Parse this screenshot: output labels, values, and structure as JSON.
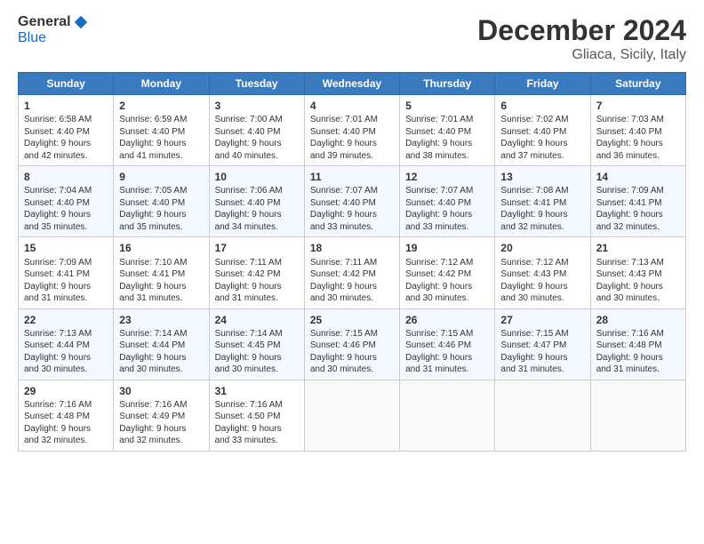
{
  "header": {
    "logo_general": "General",
    "logo_blue": "Blue",
    "title": "December 2024",
    "subtitle": "Gliaca, Sicily, Italy"
  },
  "days_of_week": [
    "Sunday",
    "Monday",
    "Tuesday",
    "Wednesday",
    "Thursday",
    "Friday",
    "Saturday"
  ],
  "weeks": [
    [
      {
        "day": "1",
        "sunrise": "6:58 AM",
        "sunset": "4:40 PM",
        "daylight": "9 hours and 42 minutes."
      },
      {
        "day": "2",
        "sunrise": "6:59 AM",
        "sunset": "4:40 PM",
        "daylight": "9 hours and 41 minutes."
      },
      {
        "day": "3",
        "sunrise": "7:00 AM",
        "sunset": "4:40 PM",
        "daylight": "9 hours and 40 minutes."
      },
      {
        "day": "4",
        "sunrise": "7:01 AM",
        "sunset": "4:40 PM",
        "daylight": "9 hours and 39 minutes."
      },
      {
        "day": "5",
        "sunrise": "7:01 AM",
        "sunset": "4:40 PM",
        "daylight": "9 hours and 38 minutes."
      },
      {
        "day": "6",
        "sunrise": "7:02 AM",
        "sunset": "4:40 PM",
        "daylight": "9 hours and 37 minutes."
      },
      {
        "day": "7",
        "sunrise": "7:03 AM",
        "sunset": "4:40 PM",
        "daylight": "9 hours and 36 minutes."
      }
    ],
    [
      {
        "day": "8",
        "sunrise": "7:04 AM",
        "sunset": "4:40 PM",
        "daylight": "9 hours and 35 minutes."
      },
      {
        "day": "9",
        "sunrise": "7:05 AM",
        "sunset": "4:40 PM",
        "daylight": "9 hours and 35 minutes."
      },
      {
        "day": "10",
        "sunrise": "7:06 AM",
        "sunset": "4:40 PM",
        "daylight": "9 hours and 34 minutes."
      },
      {
        "day": "11",
        "sunrise": "7:07 AM",
        "sunset": "4:40 PM",
        "daylight": "9 hours and 33 minutes."
      },
      {
        "day": "12",
        "sunrise": "7:07 AM",
        "sunset": "4:40 PM",
        "daylight": "9 hours and 33 minutes."
      },
      {
        "day": "13",
        "sunrise": "7:08 AM",
        "sunset": "4:41 PM",
        "daylight": "9 hours and 32 minutes."
      },
      {
        "day": "14",
        "sunrise": "7:09 AM",
        "sunset": "4:41 PM",
        "daylight": "9 hours and 32 minutes."
      }
    ],
    [
      {
        "day": "15",
        "sunrise": "7:09 AM",
        "sunset": "4:41 PM",
        "daylight": "9 hours and 31 minutes."
      },
      {
        "day": "16",
        "sunrise": "7:10 AM",
        "sunset": "4:41 PM",
        "daylight": "9 hours and 31 minutes."
      },
      {
        "day": "17",
        "sunrise": "7:11 AM",
        "sunset": "4:42 PM",
        "daylight": "9 hours and 31 minutes."
      },
      {
        "day": "18",
        "sunrise": "7:11 AM",
        "sunset": "4:42 PM",
        "daylight": "9 hours and 30 minutes."
      },
      {
        "day": "19",
        "sunrise": "7:12 AM",
        "sunset": "4:42 PM",
        "daylight": "9 hours and 30 minutes."
      },
      {
        "day": "20",
        "sunrise": "7:12 AM",
        "sunset": "4:43 PM",
        "daylight": "9 hours and 30 minutes."
      },
      {
        "day": "21",
        "sunrise": "7:13 AM",
        "sunset": "4:43 PM",
        "daylight": "9 hours and 30 minutes."
      }
    ],
    [
      {
        "day": "22",
        "sunrise": "7:13 AM",
        "sunset": "4:44 PM",
        "daylight": "9 hours and 30 minutes."
      },
      {
        "day": "23",
        "sunrise": "7:14 AM",
        "sunset": "4:44 PM",
        "daylight": "9 hours and 30 minutes."
      },
      {
        "day": "24",
        "sunrise": "7:14 AM",
        "sunset": "4:45 PM",
        "daylight": "9 hours and 30 minutes."
      },
      {
        "day": "25",
        "sunrise": "7:15 AM",
        "sunset": "4:46 PM",
        "daylight": "9 hours and 30 minutes."
      },
      {
        "day": "26",
        "sunrise": "7:15 AM",
        "sunset": "4:46 PM",
        "daylight": "9 hours and 31 minutes."
      },
      {
        "day": "27",
        "sunrise": "7:15 AM",
        "sunset": "4:47 PM",
        "daylight": "9 hours and 31 minutes."
      },
      {
        "day": "28",
        "sunrise": "7:16 AM",
        "sunset": "4:48 PM",
        "daylight": "9 hours and 31 minutes."
      }
    ],
    [
      {
        "day": "29",
        "sunrise": "7:16 AM",
        "sunset": "4:48 PM",
        "daylight": "9 hours and 32 minutes."
      },
      {
        "day": "30",
        "sunrise": "7:16 AM",
        "sunset": "4:49 PM",
        "daylight": "9 hours and 32 minutes."
      },
      {
        "day": "31",
        "sunrise": "7:16 AM",
        "sunset": "4:50 PM",
        "daylight": "9 hours and 33 minutes."
      },
      null,
      null,
      null,
      null
    ]
  ],
  "labels": {
    "sunrise": "Sunrise:",
    "sunset": "Sunset:",
    "daylight": "Daylight:"
  }
}
